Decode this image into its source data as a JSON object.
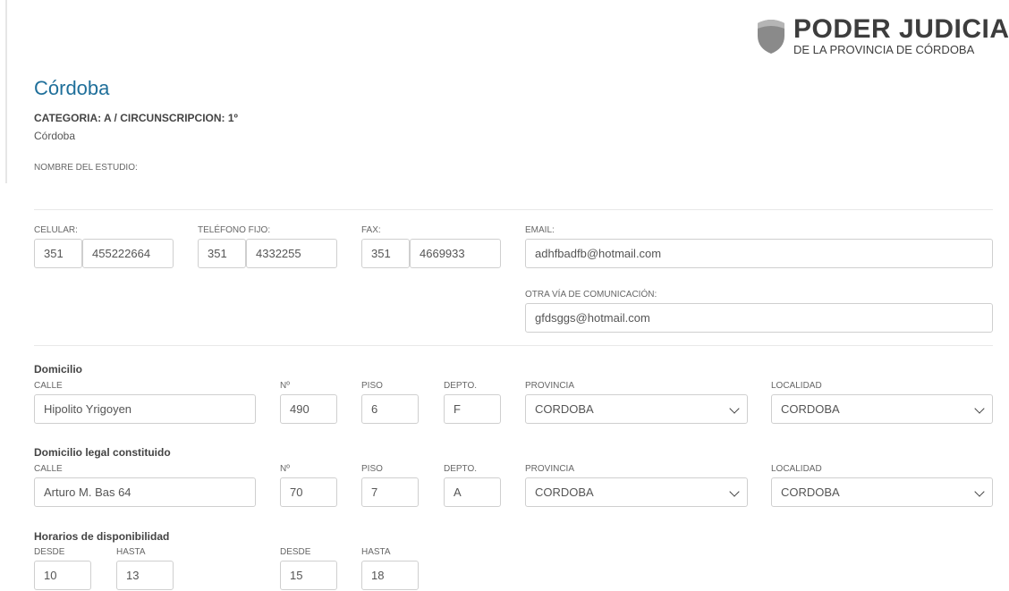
{
  "header": {
    "logo_title": "PODER JUDICIAL",
    "logo_subtitle": "DE LA PROVINCIA DE CÓRDOBA"
  },
  "page": {
    "title": "Córdoba",
    "category": "CATEGORIA: A / CIRCUNSCRIPCION: 1º",
    "city": "Córdoba",
    "studio_label": "NOMBRE DEL ESTUDIO:"
  },
  "contact": {
    "celular_label": "CELULAR:",
    "celular_area": "351",
    "celular_number": "455222664",
    "fijo_label": "TELÉFONO FIJO:",
    "fijo_area": "351",
    "fijo_number": "4332255",
    "fax_label": "FAX:",
    "fax_area": "351",
    "fax_number": "4669933",
    "email_label": "EMAIL:",
    "email_value": "adhfbadfb@hotmail.com",
    "otra_label": "OTRA VÍA DE COMUNICACIÓN:",
    "otra_value": "gfdsggs@hotmail.com"
  },
  "domicilio": {
    "heading": "Domicilio",
    "calle_label": "CALLE",
    "calle": "Hipolito Yrigoyen",
    "numero_label": "Nº",
    "numero": "490",
    "piso_label": "PISO",
    "piso": "6",
    "depto_label": "DEPTO.",
    "depto": "F",
    "provincia_label": "PROVINCIA",
    "provincia": "CORDOBA",
    "localidad_label": "LOCALIDAD",
    "localidad": "CORDOBA"
  },
  "domicilio_legal": {
    "heading": "Domicilio legal constituido",
    "calle_label": "CALLE",
    "calle": "Arturo M. Bas 64",
    "numero_label": "Nº",
    "numero": "70",
    "piso_label": "PISO",
    "piso": "7",
    "depto_label": "DEPTO.",
    "depto": "A",
    "provincia_label": "PROVINCIA",
    "provincia": "CORDOBA",
    "localidad_label": "LOCALIDAD",
    "localidad": "CORDOBA"
  },
  "horarios": {
    "heading": "Horarios de disponibilidad",
    "desde_label": "DESDE",
    "hasta_label": "HASTA",
    "desde1": "10",
    "hasta1": "13",
    "desde2": "15",
    "hasta2": "18"
  }
}
